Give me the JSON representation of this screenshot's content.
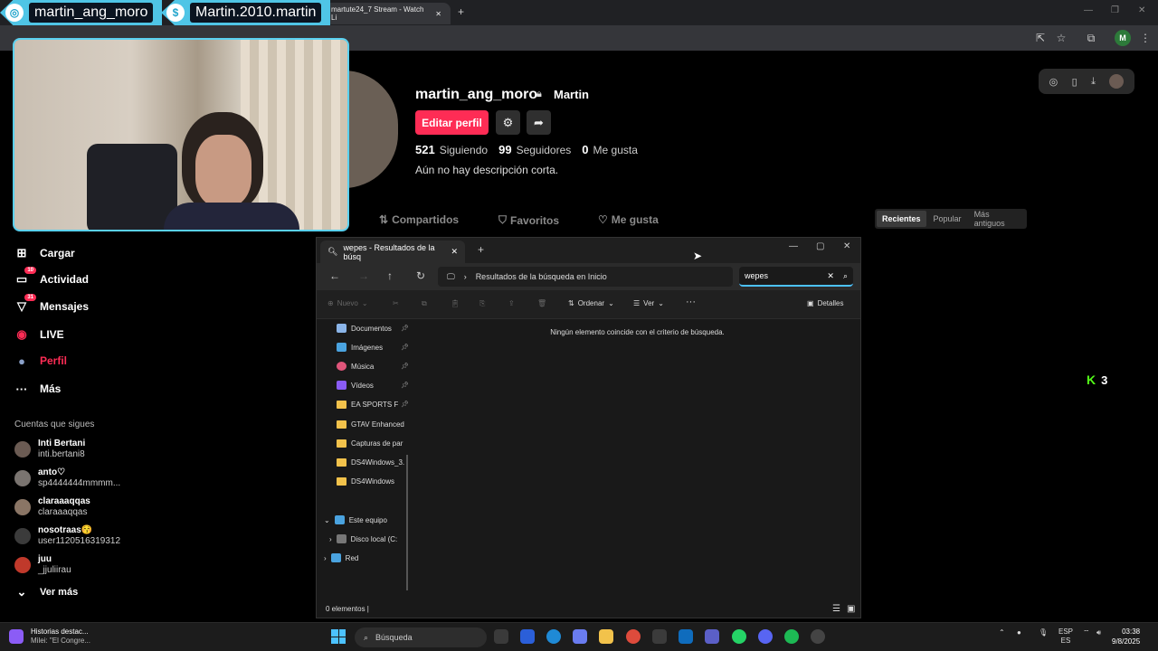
{
  "browser": {
    "tabs": [
      "martute24_7 Stream - Watch Li"
    ],
    "new_tab": "+",
    "controls": [
      "—",
      "❐",
      "✕"
    ],
    "profile_initial": "M"
  },
  "overlay": {
    "instagram": "martin_ang_moro",
    "donation": "Martin.2010.martin",
    "instagram_icon": "◎",
    "donation_icon": "$"
  },
  "profile": {
    "username": "martin_ang_moro",
    "nickname": "Martin",
    "edit_label": "Editar perfil",
    "following_count": "521",
    "following_label": "Siguiendo",
    "followers_count": "99",
    "followers_label": "Seguidores",
    "likes_count": "0",
    "likes_label": "Me gusta",
    "bio": "Aún no hay descripción corta.",
    "tabs": [
      "Compartidos",
      "Favoritos",
      "Me gusta"
    ],
    "sort": [
      "Recientes",
      "Popular",
      "Más antiguos"
    ],
    "kick_count": "3"
  },
  "sidebar": {
    "items": [
      {
        "label": "Cargar",
        "icon": "⊞",
        "badge": ""
      },
      {
        "label": "Actividad",
        "icon": "▭",
        "badge": "10"
      },
      {
        "label": "Mensajes",
        "icon": "▽",
        "badge": "31"
      },
      {
        "label": "LIVE",
        "icon": "◉",
        "badge": ""
      },
      {
        "label": "Perfil",
        "icon": "●",
        "badge": ""
      },
      {
        "label": "Más",
        "icon": "···",
        "badge": ""
      }
    ],
    "following_header": "Cuentas que sigues",
    "following": [
      {
        "name": "Inti Bertani",
        "handle": "inti.bertani8"
      },
      {
        "name": "anto♡",
        "handle": "sp4444444mmmm..."
      },
      {
        "name": "claraaaqqas",
        "handle": "claraaaqqas"
      },
      {
        "name": "nosotraas😚",
        "handle": "user1120516319312"
      },
      {
        "name": "juu",
        "handle": "_jjuliirau"
      }
    ],
    "see_more": "Ver más"
  },
  "explorer": {
    "tab_title": "wepes - Resultados de la búsq",
    "address": "Resultados de la búsqueda en Inicio",
    "search_value": "wepes",
    "cmd": {
      "nuevo": "Nuevo",
      "ordenar": "Ordenar",
      "ver": "Ver",
      "more": "···",
      "detalles": "Detalles"
    },
    "side": [
      {
        "label": "Documentos",
        "kind": "doc",
        "pinned": true
      },
      {
        "label": "Imágenes",
        "kind": "img",
        "pinned": true
      },
      {
        "label": "Música",
        "kind": "music",
        "pinned": true
      },
      {
        "label": "Vídeos",
        "kind": "video",
        "pinned": true
      },
      {
        "label": "EA SPORTS F",
        "kind": "folder",
        "pinned": true
      },
      {
        "label": "GTAV Enhanced",
        "kind": "folder",
        "pinned": false
      },
      {
        "label": "Capturas de par",
        "kind": "folder",
        "pinned": false
      },
      {
        "label": "DS4Windows_3.",
        "kind": "folder",
        "pinned": false
      },
      {
        "label": "DS4Windows",
        "kind": "folder",
        "pinned": false
      }
    ],
    "tree": [
      {
        "label": "Este equipo",
        "expander": "⌄"
      },
      {
        "label": "Disco local (C:",
        "expander": "›"
      },
      {
        "label": "Red",
        "expander": "›"
      }
    ],
    "empty_message": "Ningún elemento coincide con el criterio de búsqueda.",
    "status": "0 elementos  |"
  },
  "taskbar": {
    "news_title": "Historias destac...",
    "news_sub": "Milei: \"El Congre...",
    "search_placeholder": "Búsqueda",
    "lang1": "ESP",
    "lang2": "ES",
    "time": "03:38",
    "date": "9/8/2025"
  }
}
